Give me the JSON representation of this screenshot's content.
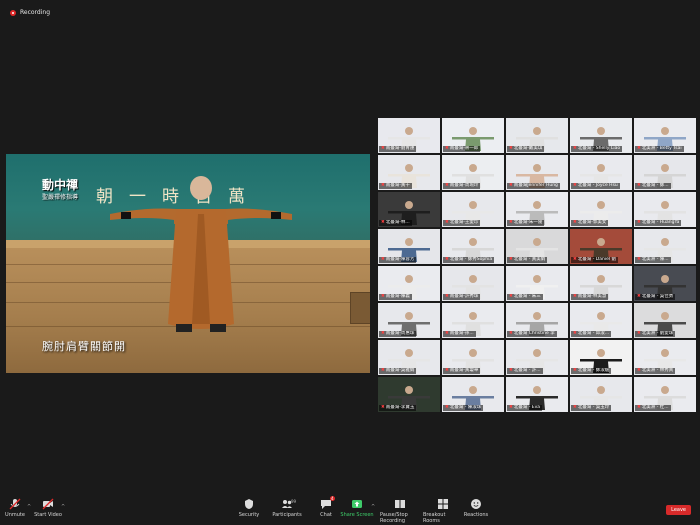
{
  "recording": {
    "label": "Recording"
  },
  "main_video": {
    "title": "動中禪",
    "subtitle": "聖嚴禪修指導",
    "banner": "朝一時古萬",
    "caption": "腕肘肩臂關節開"
  },
  "gallery": {
    "tiles": [
      {
        "name": "南臺灣-劉青蓮",
        "bg": "#e8e9ee",
        "shirt": "#e6e6e6"
      },
      {
        "name": "南臺灣-蔣一郎",
        "bg": "#eceef2",
        "shirt": "#7a9a6e"
      },
      {
        "name": "北臺灣-戴美琪",
        "bg": "#e6e8ec",
        "shirt": "#e0e0e0"
      },
      {
        "name": "北臺灣 - Shelly Liao",
        "bg": "#e9ebee",
        "shirt": "#6b6b6b"
      },
      {
        "name": "北美洲 - Betty Tsai",
        "bg": "#eaebef",
        "shirt": "#8fa6c7"
      },
      {
        "name": "南臺灣-黃千",
        "bg": "#e7e8ec",
        "shirt": "#e9e4dc"
      },
      {
        "name": "南臺灣-周琬玲",
        "bg": "#eceef1",
        "shirt": "#e0e0e0"
      },
      {
        "name": "南臺灣Jennifer Hung",
        "bg": "#e8e9ed",
        "shirt": "#d9b8a2"
      },
      {
        "name": "北臺灣 - Joyce Hsu",
        "bg": "#e9eaee",
        "shirt": "#e6e6e6"
      },
      {
        "name": "北臺灣 - 鄭...",
        "bg": "#e6e7eb",
        "shirt": "#d5d5d5"
      },
      {
        "name": "北臺灣-林...",
        "bg": "#3a3a3a",
        "shirt": "#1e1e1e"
      },
      {
        "name": "北臺灣-王愛珍",
        "bg": "#e7e8ec",
        "shirt": "#e8e8e8"
      },
      {
        "name": "北臺灣-朱一陵",
        "bg": "#eaebef",
        "shirt": "#bbbbbb"
      },
      {
        "name": "北臺灣-郭美女",
        "bg": "#e8e9ed",
        "shirt": "#ececec"
      },
      {
        "name": "北臺灣 - HuangYa",
        "bg": "#e9eaee",
        "shirt": "#e3e3e3"
      },
      {
        "name": "南臺灣-陳蓉芳",
        "bg": "#e5e6ea",
        "shirt": "#4d6a92"
      },
      {
        "name": "北臺灣 - 鄭秀Sophia",
        "bg": "#e8e9ed",
        "shirt": "#d8d8d8"
      },
      {
        "name": "北臺灣 - 黃美娟",
        "bg": "#d9d9da",
        "shirt": "#e4e4e4"
      },
      {
        "name": "北臺灣 - Daniel 劉",
        "bg": "#a44b3a",
        "shirt": "#4a3a2a"
      },
      {
        "name": "北美洲 - 陳...",
        "bg": "#e7e8ec",
        "shirt": "#e6e6e6"
      },
      {
        "name": "南臺灣-陳義",
        "bg": "#eaebef",
        "shirt": "#ececec"
      },
      {
        "name": "南臺灣-許秀珠",
        "bg": "#e6e7eb",
        "shirt": "#e3e3e3"
      },
      {
        "name": "北臺灣 - 朱三",
        "bg": "#e9eaee",
        "shirt": "#f0f0f0"
      },
      {
        "name": "南臺灣-林美慧",
        "bg": "#e8e9ed",
        "shirt": "#d8d8d8"
      },
      {
        "name": "北臺灣 - 吳佳勇",
        "bg": "#484b52",
        "shirt": "#333"
      },
      {
        "name": "南臺灣-周惠珠",
        "bg": "#e7e8ec",
        "shirt": "#6e6e6e"
      },
      {
        "name": "南臺灣-孫...",
        "bg": "#eaebef",
        "shirt": "#e0e0e0"
      },
      {
        "name": "北臺灣 Christine 李",
        "bg": "#e8e9ed",
        "shirt": "#a6a6a6"
      },
      {
        "name": "北臺灣 - 邱淑...",
        "bg": "#e9eaee",
        "shirt": "#e9e9e9"
      },
      {
        "name": "北美洲 - 劉愛珠",
        "bg": "#dcdcdd",
        "shirt": "#4a4a4a"
      },
      {
        "name": "南臺灣-吳雅娟",
        "bg": "#e7e8ec",
        "shirt": "#e6e6e6"
      },
      {
        "name": "南臺灣-黃瓊華",
        "bg": "#e9eaee",
        "shirt": "#e3e3e3"
      },
      {
        "name": "北臺灣 - 許...",
        "bg": "#e8e9ed",
        "shirt": "#e6e6e6"
      },
      {
        "name": "北臺灣 - 鄭淑媛",
        "bg": "#f2f2f2",
        "shirt": "#1c1c1c"
      },
      {
        "name": "北美洲 - 林秀真",
        "bg": "#eaebef",
        "shirt": "#e8e8e8"
      },
      {
        "name": "南臺灣-李寶玉",
        "bg": "#2f3a2f",
        "shirt": "#3a3a3a"
      },
      {
        "name": "北臺灣 - 陳淑珠",
        "bg": "#e8e9ed",
        "shirt": "#6a7ea0"
      },
      {
        "name": "北臺灣 - Eva",
        "bg": "#e9eaee",
        "shirt": "#2a2a2a"
      },
      {
        "name": "北臺灣 - 吳玉玲",
        "bg": "#e7e8ec",
        "shirt": "#e6e6e6"
      },
      {
        "name": "北美洲 - 杜...",
        "bg": "#eaebef",
        "shirt": "#dcdcdc"
      }
    ]
  },
  "toolbar": {
    "unmute": "Unmute",
    "start_video": "Start Video",
    "security": "Security",
    "participants": "Participants",
    "participants_count": "99",
    "chat": "Chat",
    "chat_badge": "4",
    "share_screen": "Share Screen",
    "pause_recording": "Pause/Stop Recording",
    "breakout": "Breakout Rooms",
    "reactions": "Reactions",
    "leave": "Leave"
  },
  "colors": {
    "accent_green": "#3ecb6a",
    "leave_red": "#d72a2a",
    "background": "#1a1a1a"
  }
}
